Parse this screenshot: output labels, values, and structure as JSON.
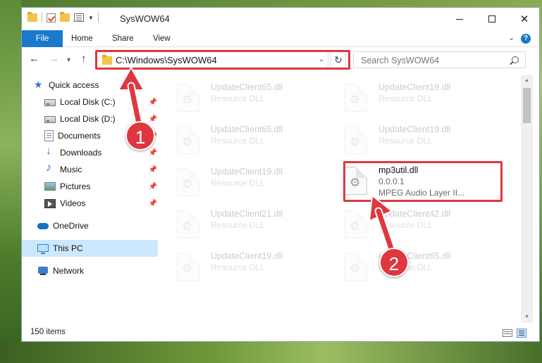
{
  "window": {
    "title": "SysWOW64",
    "controls": {
      "minimize": "",
      "maximize": "",
      "close": "✕"
    }
  },
  "ribbon": {
    "tabs": [
      "File",
      "Home",
      "Share",
      "View"
    ],
    "help": "?"
  },
  "navigation": {
    "address": "C:\\Windows\\SysWOW64",
    "search_placeholder": "Search SysWOW64"
  },
  "sidebar": {
    "items": [
      {
        "label": "Quick access",
        "icon": "star-icon"
      },
      {
        "label": "Local Disk (C:)",
        "icon": "drive-icon",
        "pinned": true
      },
      {
        "label": "Local Disk (D:)",
        "icon": "drive-icon",
        "pinned": true
      },
      {
        "label": "Documents",
        "icon": "documents-icon",
        "pinned": true
      },
      {
        "label": "Downloads",
        "icon": "downloads-icon",
        "pinned": true
      },
      {
        "label": "Music",
        "icon": "music-icon",
        "pinned": true
      },
      {
        "label": "Pictures",
        "icon": "pictures-icon",
        "pinned": true
      },
      {
        "label": "Videos",
        "icon": "videos-icon",
        "pinned": true
      },
      {
        "label": "OneDrive",
        "icon": "onedrive-icon"
      },
      {
        "label": "This PC",
        "icon": "this-pc-icon",
        "selected": true
      },
      {
        "label": "Network",
        "icon": "network-icon"
      }
    ]
  },
  "files": [
    {
      "name": "UpdateClient65.dll",
      "desc": "Resource DLL"
    },
    {
      "name": "UpdateClient19.dll",
      "desc": "Resource DLL"
    },
    {
      "name": "UpdateClient65.dll",
      "desc": "Resource DLL"
    },
    {
      "name": "UpdateClient19.dll",
      "desc": "Resource DLL"
    },
    {
      "name": "UpdateClient19.dll",
      "desc": "Resource DLL"
    },
    {
      "name": "mp3util.dll",
      "version": "0.0.0.1",
      "desc": "MPEG Audio Layer II..."
    },
    {
      "name": "UpdateClient21.dll",
      "desc": "Resource DLL"
    },
    {
      "name": "UpdateClient42.dll",
      "desc": "Resource DLL"
    },
    {
      "name": "UpdateClient19.dll",
      "desc": "Resource DLL"
    },
    {
      "name": "UpdateClient65.dll",
      "desc": "Resource DLL"
    }
  ],
  "status": {
    "items_count": "150 items"
  },
  "annotations": {
    "step1": "1",
    "step2": "2",
    "highlight_color": "#e0373f"
  },
  "colors": {
    "accent": "#1979ca",
    "selection": "#cce8ff"
  }
}
